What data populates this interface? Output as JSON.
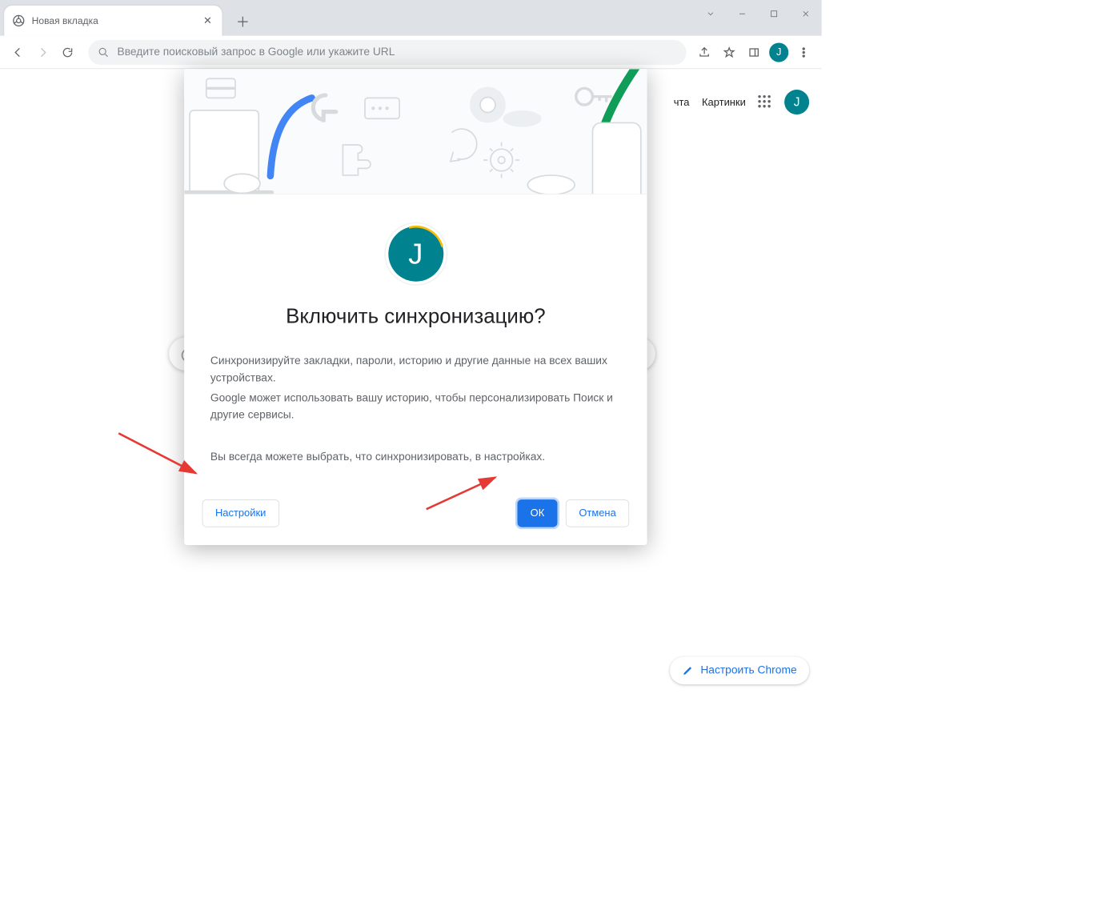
{
  "window": {
    "minimize": "—",
    "maximize": "",
    "close": "",
    "chevron": ""
  },
  "tab": {
    "title": "Новая вкладка",
    "avatar_letter": "J"
  },
  "toolbar": {
    "omnibox_placeholder": "Введите поисковый запрос в Google или укажите URL"
  },
  "ntp": {
    "mail_label": "чта",
    "images_label": "Картинки",
    "avatar_letter": "J"
  },
  "modal": {
    "avatar_letter": "J",
    "title": "Включить синхронизацию?",
    "para1": "Синхронизируйте закладки, пароли, историю и другие данные на всех ваших устройствах.",
    "para2": "Google может использовать вашу историю, чтобы персонализировать Поиск и другие сервисы.",
    "para3": "Вы всегда можете выбрать, что синхронизировать, в настройках.",
    "settings_label": "Настройки",
    "ok_label": "ОК",
    "cancel_label": "Отмена"
  },
  "customize": {
    "label": "Настроить Chrome"
  }
}
